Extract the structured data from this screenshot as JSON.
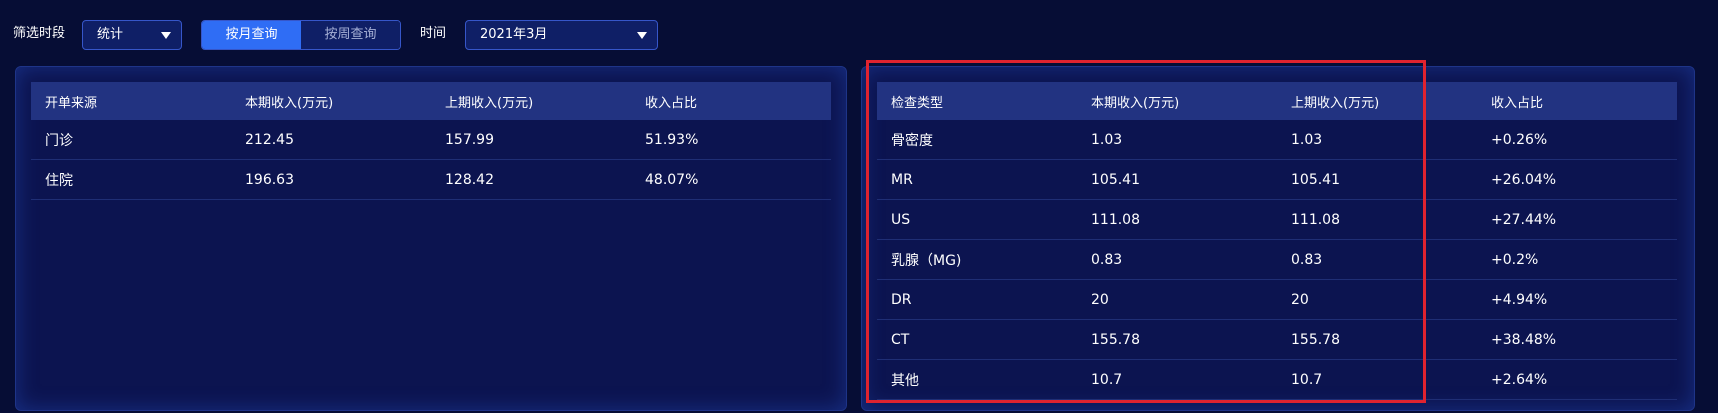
{
  "filter": {
    "period_label": "筛选时段",
    "period_value": "统计",
    "query_by_month": "按月查询",
    "query_by_week": "按周查询",
    "time_label": "时间",
    "time_value": "2021年3月"
  },
  "source_table": {
    "headers": [
      "开单来源",
      "本期收入(万元)",
      "上期收入(万元)",
      "收入占比"
    ],
    "rows": [
      [
        "门诊",
        "212.45",
        "157.99",
        "51.93%"
      ],
      [
        "住院",
        "196.63",
        "128.42",
        "48.07%"
      ]
    ]
  },
  "exam_table": {
    "headers": [
      "检查类型",
      "本期收入(万元)",
      "上期收入(万元)",
      "收入占比"
    ],
    "rows": [
      [
        "骨密度",
        "1.03",
        "1.03",
        "+0.26%"
      ],
      [
        "MR",
        "105.41",
        "105.41",
        "+26.04%"
      ],
      [
        "US",
        "111.08",
        "111.08",
        "+27.44%"
      ],
      [
        "乳腺（MG)",
        "0.83",
        "0.83",
        "+0.2%"
      ],
      [
        "DR",
        "20",
        "20",
        "+4.94%"
      ],
      [
        "CT",
        "155.78",
        "155.78",
        "+38.48%"
      ],
      [
        "其他",
        "10.7",
        "10.7",
        "+2.64%"
      ]
    ]
  },
  "colors": {
    "background": "#060d35",
    "panel": "#0c1450",
    "header_row": "#223381",
    "active_toggle": "#2f6df5",
    "highlight": "#e0232f"
  }
}
